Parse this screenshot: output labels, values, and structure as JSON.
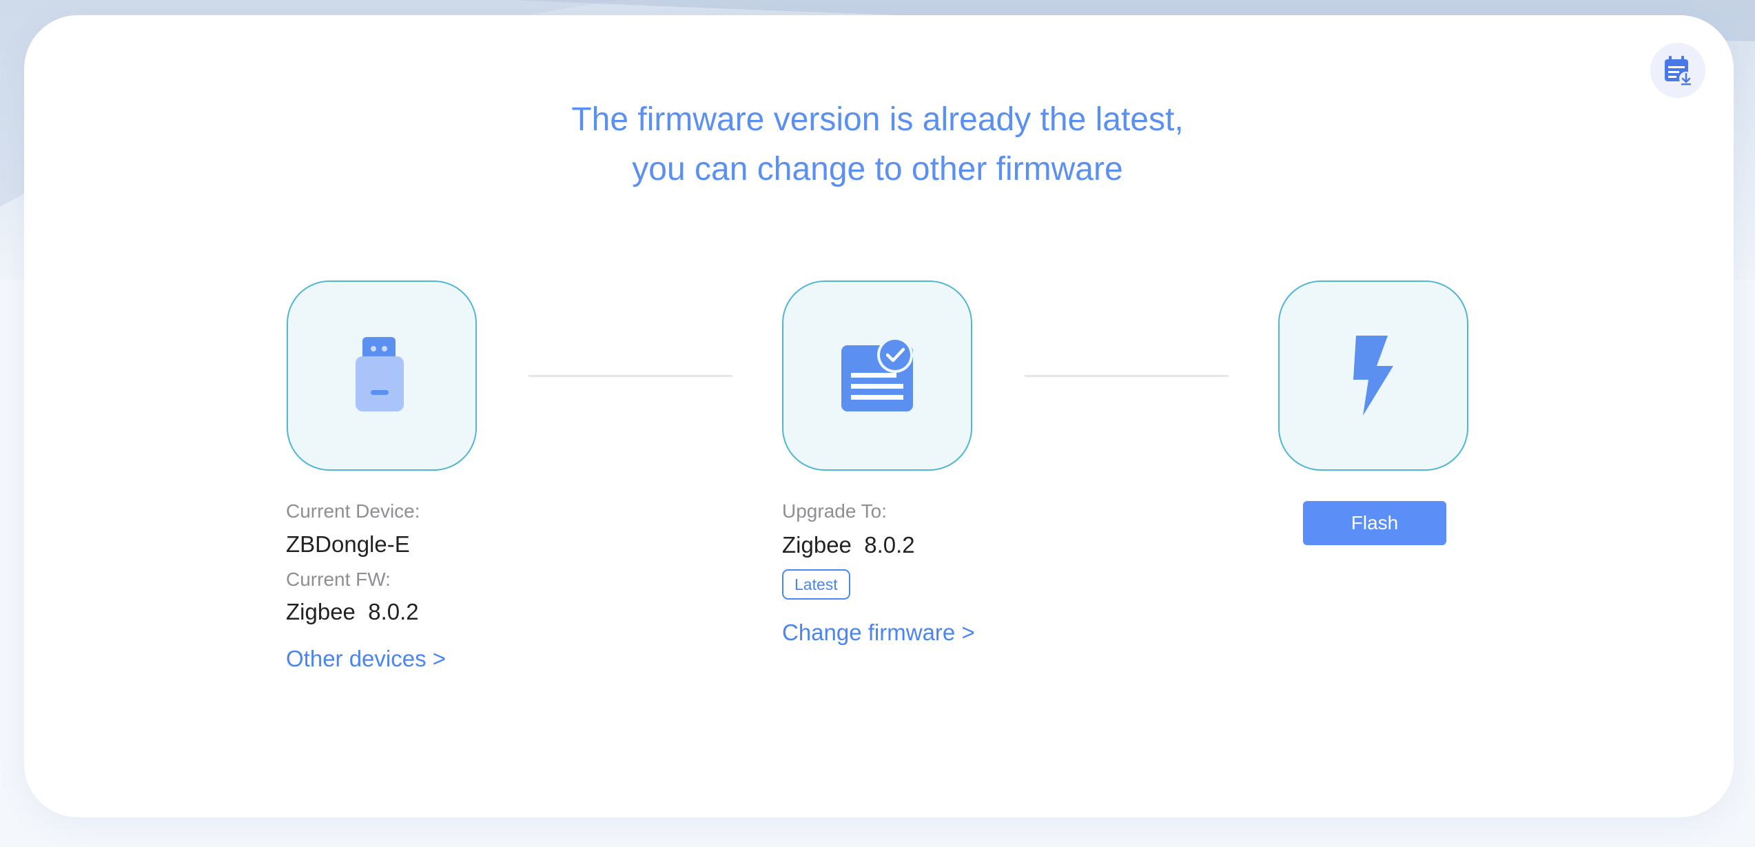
{
  "header": {
    "title_line1": "The firmware version is already the latest,",
    "title_line2": "you can change to other firmware",
    "download_icon": "calendar-download-icon"
  },
  "device": {
    "icon": "usb-dongle-icon",
    "current_device_label": "Current Device:",
    "current_device_value": "ZBDongle-E",
    "current_fw_label": "Current FW:",
    "current_fw_value": "Zigbee  8.0.2",
    "other_devices_link": "Other devices >"
  },
  "upgrade": {
    "icon": "document-check-icon",
    "upgrade_to_label": "Upgrade To:",
    "upgrade_to_value": "Zigbee  8.0.2",
    "badge": "Latest",
    "change_firmware_link": "Change firmware >"
  },
  "flash": {
    "icon": "lightning-bolt-icon",
    "button_label": "Flash"
  },
  "colors": {
    "accent": "#5b8ff0",
    "box_border": "#52b6d2",
    "box_fill": "#eef8fa",
    "button": "#5b8ff7"
  }
}
